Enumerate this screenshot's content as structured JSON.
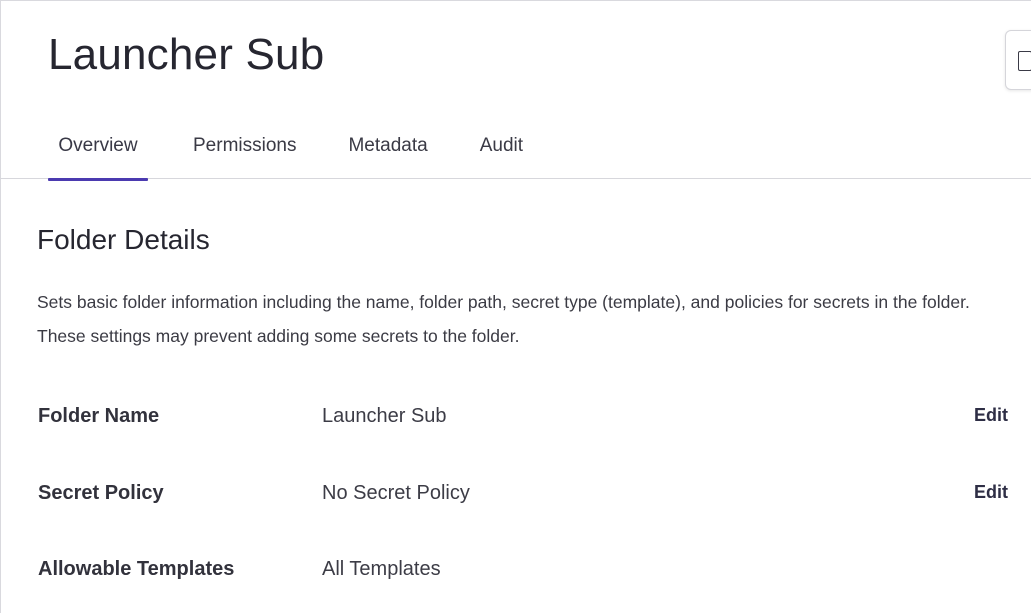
{
  "header": {
    "title": "Launcher Sub",
    "corner_action_icon": "copy-icon"
  },
  "tabs": [
    {
      "label": "Overview",
      "active": true
    },
    {
      "label": "Permissions",
      "active": false
    },
    {
      "label": "Metadata",
      "active": false
    },
    {
      "label": "Audit",
      "active": false
    }
  ],
  "section": {
    "title": "Folder Details",
    "description": "Sets basic folder information including the name, folder path, secret type (template), and policies for secrets in the folder. These settings may prevent adding some secrets to the folder."
  },
  "details": [
    {
      "label": "Folder Name",
      "value": "Launcher Sub",
      "action": "Edit"
    },
    {
      "label": "Secret Policy",
      "value": "No Secret Policy",
      "action": "Edit"
    },
    {
      "label": "Allowable Templates",
      "value": "All Templates",
      "action": ""
    }
  ],
  "colors": {
    "accent": "#4b3ab0",
    "text": "#262630",
    "divider": "#d7d7dc"
  }
}
